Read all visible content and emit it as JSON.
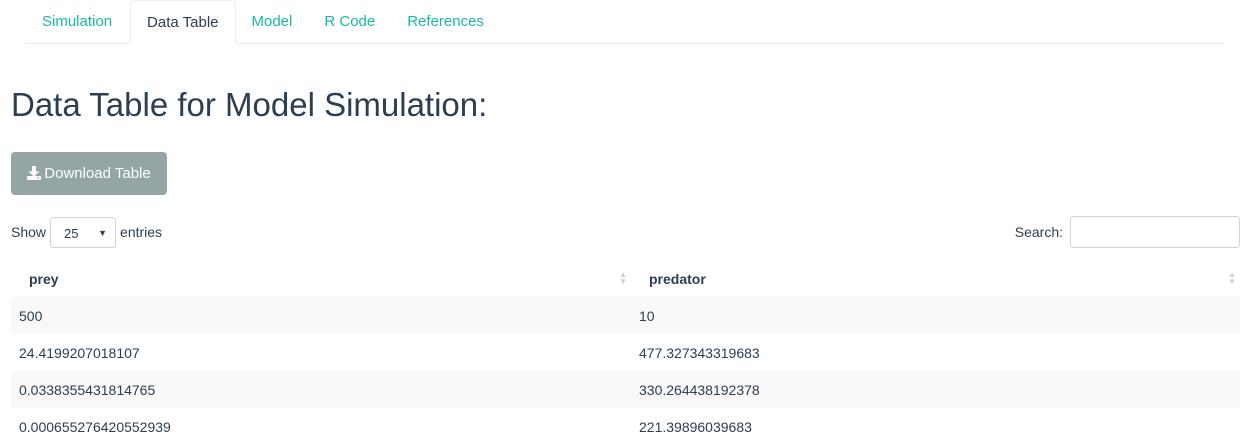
{
  "tabs": [
    {
      "label": "Simulation",
      "active": false
    },
    {
      "label": "Data Table",
      "active": true
    },
    {
      "label": "Model",
      "active": false
    },
    {
      "label": "R Code",
      "active": false
    },
    {
      "label": "References",
      "active": false
    }
  ],
  "heading": "Data Table for Model Simulation:",
  "download": {
    "label": "Download Table",
    "icon": "download-icon"
  },
  "length": {
    "show_label": "Show",
    "selected": "25",
    "entries_label": "entries"
  },
  "search": {
    "label": "Search:",
    "value": "",
    "placeholder": ""
  },
  "table": {
    "columns": [
      "prey",
      "predator"
    ],
    "rows": [
      [
        "500",
        "10"
      ],
      [
        "24.4199207018107",
        "477.327343319683"
      ],
      [
        "0.0338355431814765",
        "330.264438192378"
      ],
      [
        "0.000655276420552939",
        "221.39896039683"
      ]
    ]
  },
  "colors": {
    "accent": "#18bc9c",
    "text": "#2c3e50",
    "button": "#95a5a6",
    "stripe": "#f9f9f9"
  }
}
